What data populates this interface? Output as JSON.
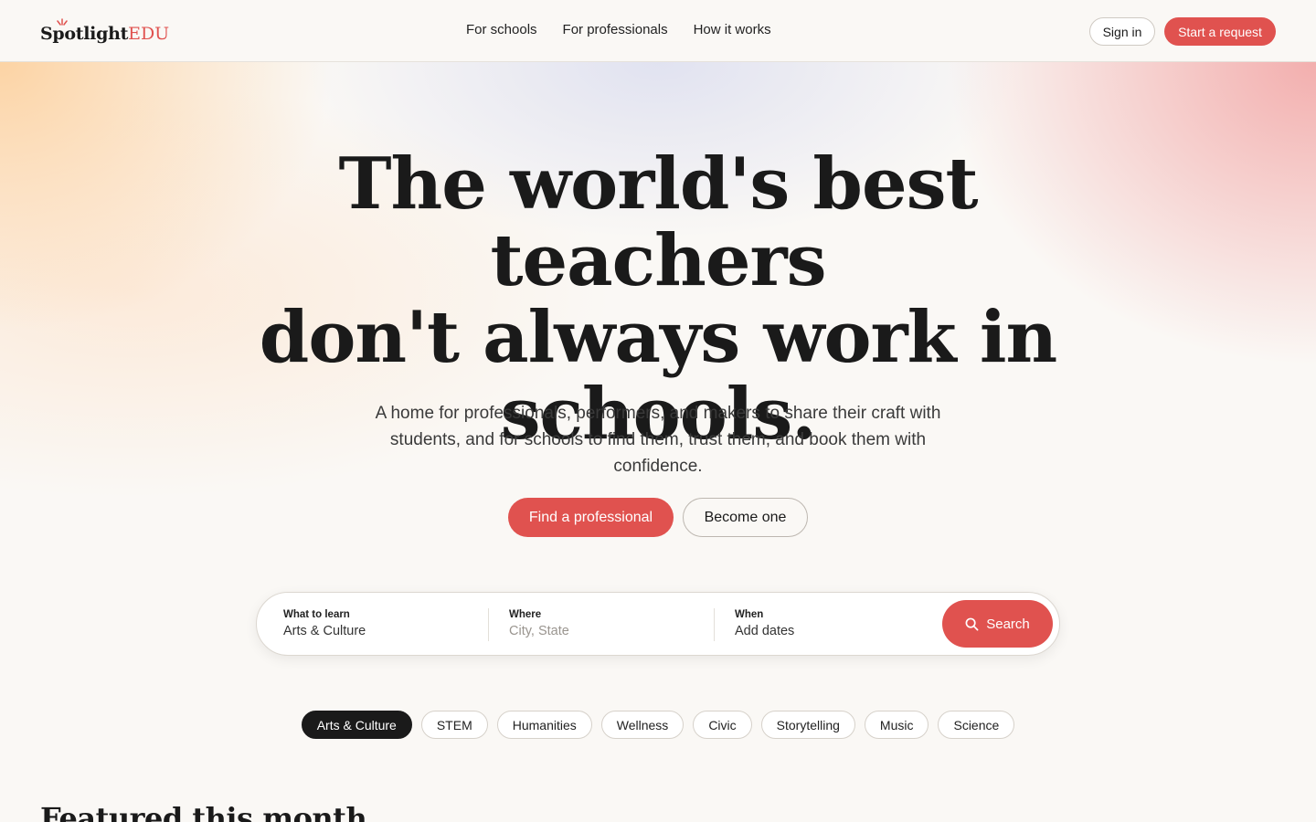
{
  "brand": {
    "name_part1": "Spotlight",
    "name_part2": "EDU",
    "accent": "#e0524f"
  },
  "nav": {
    "items": [
      "For schools",
      "For professionals",
      "How it works"
    ]
  },
  "header": {
    "signin_label": "Sign in",
    "start_label": "Start a request"
  },
  "hero": {
    "title_line1": "The world's best teachers",
    "title_line2": "don't always work in",
    "title_line3": "schools.",
    "subtitle": "A home for professionals, performers, and makers to share their craft with students, and for schools to find them, trust them, and book them with confidence.",
    "primary_label": "Find a professional",
    "secondary_label": "Become one"
  },
  "search": {
    "what_label": "What to learn",
    "what_value": "Arts & Culture",
    "where_label": "Where",
    "where_placeholder": "City, State",
    "when_label": "When",
    "when_value": "Add dates",
    "button_label": "Search",
    "button_icon": "search-icon"
  },
  "categories": [
    "Arts & Culture",
    "STEM",
    "Humanities",
    "Wellness",
    "Civic",
    "Storytelling",
    "Music",
    "Science"
  ],
  "selected_category": "Arts & Culture",
  "featured": {
    "title": "Featured this month"
  }
}
